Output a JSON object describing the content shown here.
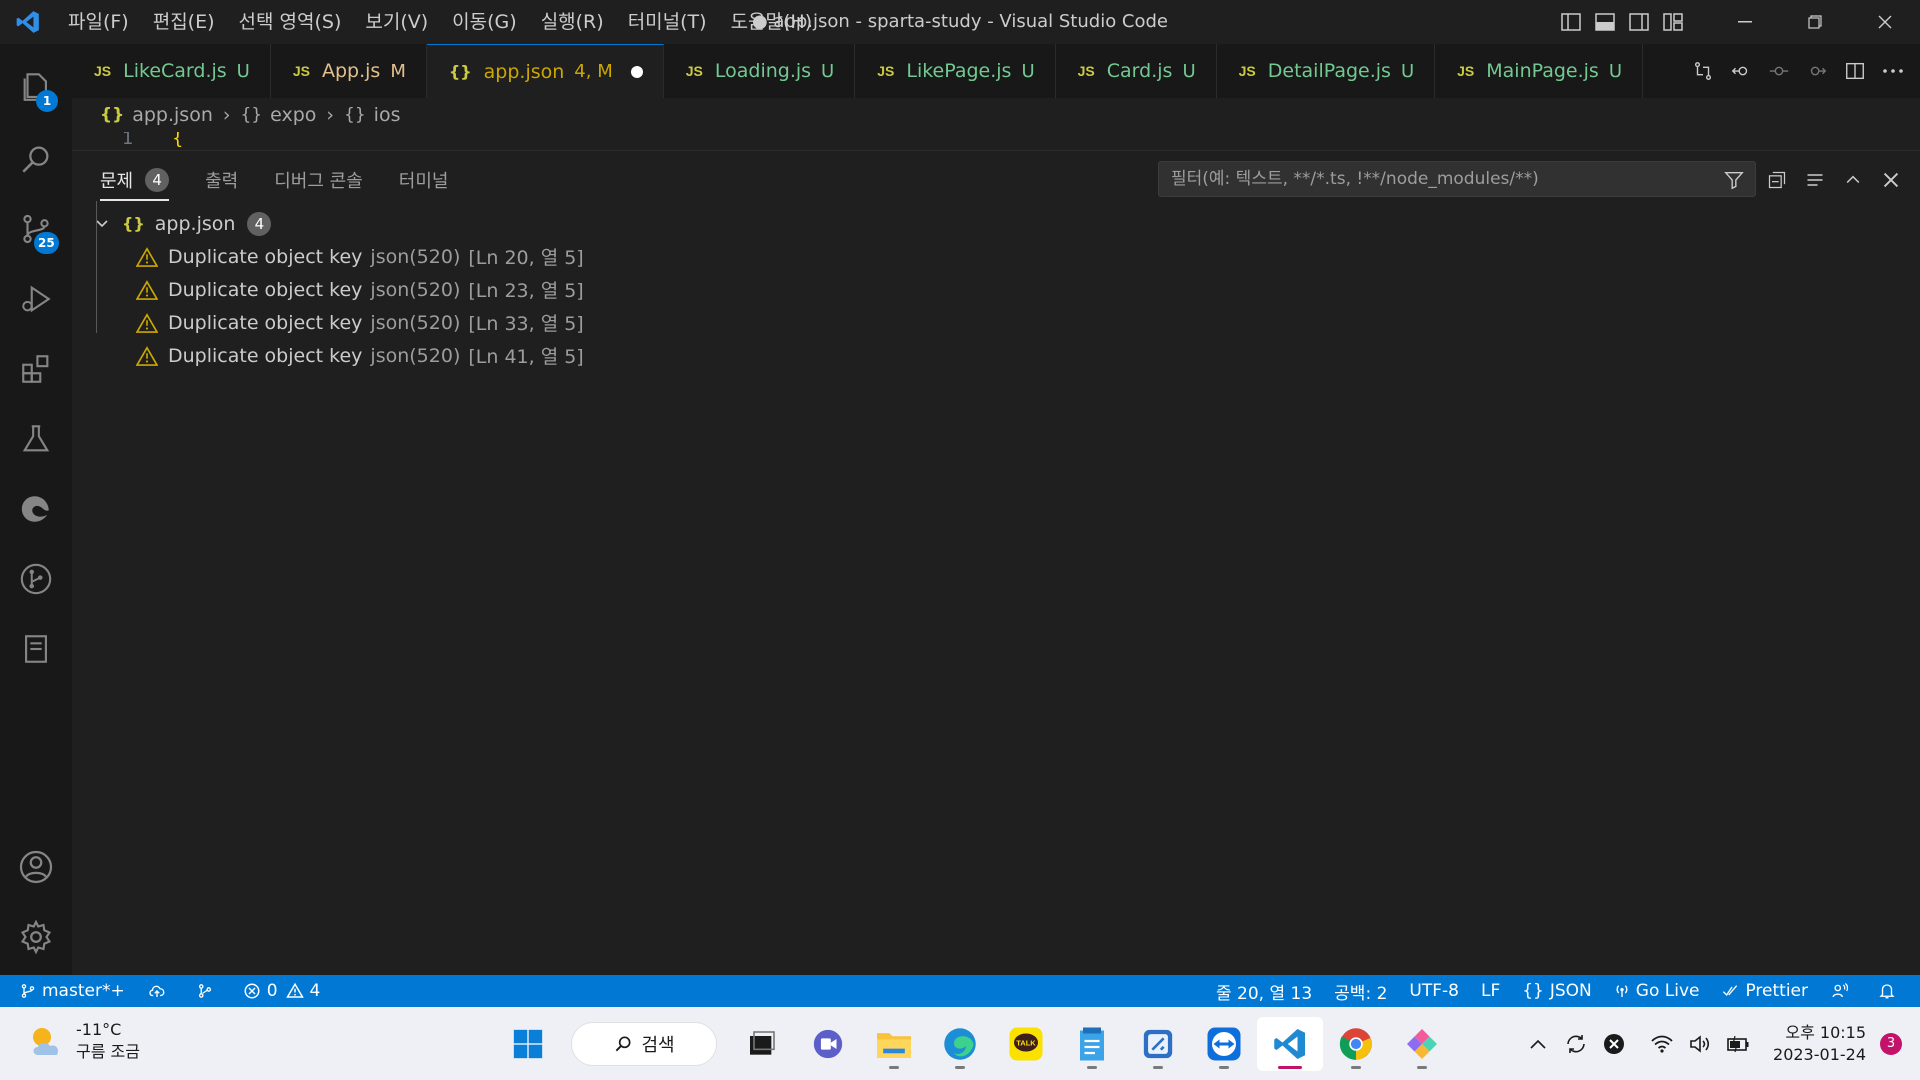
{
  "window": {
    "title": "● app.json - sparta-study - Visual Studio Code",
    "menu": [
      "파일(F)",
      "편집(E)",
      "선택 영역(S)",
      "보기(V)",
      "이동(G)",
      "실행(R)",
      "터미널(T)",
      "도움말(H)"
    ]
  },
  "activity": {
    "explorer_badge": "1",
    "scm_badge": "25"
  },
  "tabs": [
    {
      "label": "LikeCard.js",
      "status": "U",
      "kind": "js",
      "color": "#73c991"
    },
    {
      "label": "App.js",
      "status": "M",
      "kind": "js",
      "color": "#e2c08d"
    },
    {
      "label": "app.json",
      "status": "4, M",
      "kind": "json",
      "color": "#cca700",
      "active": true
    },
    {
      "label": "Loading.js",
      "status": "U",
      "kind": "js",
      "color": "#73c991"
    },
    {
      "label": "LikePage.js",
      "status": "U",
      "kind": "js",
      "color": "#73c991"
    },
    {
      "label": "Card.js",
      "status": "U",
      "kind": "js",
      "color": "#73c991"
    },
    {
      "label": "DetailPage.js",
      "status": "U",
      "kind": "js",
      "color": "#73c991"
    },
    {
      "label": "MainPage.js",
      "status": "U",
      "kind": "js",
      "color": "#73c991"
    }
  ],
  "tab_icons": {
    "js": "JS",
    "json": "{}"
  },
  "breadcrumb": [
    "app.json",
    "expo",
    "ios"
  ],
  "breadcrumb_icon": "{}",
  "editor": {
    "line_number": "1",
    "line_text": "{"
  },
  "panel": {
    "tabs": [
      "문제",
      "출력",
      "디버그 콘솔",
      "터미널"
    ],
    "problems_count": "4",
    "filter_placeholder": "필터(예: 텍스트, **/*.ts, !**/node_modules/**)",
    "file": {
      "icon": "{}",
      "name": "app.json",
      "count": "4"
    },
    "problems": [
      {
        "message": "Duplicate object key",
        "source": "json(520)",
        "location": "[Ln 20, 열 5]"
      },
      {
        "message": "Duplicate object key",
        "source": "json(520)",
        "location": "[Ln 23, 열 5]"
      },
      {
        "message": "Duplicate object key",
        "source": "json(520)",
        "location": "[Ln 33, 열 5]"
      },
      {
        "message": "Duplicate object key",
        "source": "json(520)",
        "location": "[Ln 41, 열 5]"
      }
    ]
  },
  "statusbar": {
    "branch": "master*+",
    "errors": "0",
    "warnings": "4",
    "cursor": "줄 20, 열 13",
    "indent": "공백: 2",
    "encoding": "UTF-8",
    "eol": "LF",
    "language": "JSON",
    "golive": "Go Live",
    "prettier": "Prettier",
    "accent": "#0078d4"
  },
  "taskbar": {
    "temperature": "-11°C",
    "weather": "구름 조금",
    "search": "검색",
    "time": "오후 10:15",
    "date": "2023-01-24",
    "notifications": "3",
    "kakao_label": "TALK"
  }
}
